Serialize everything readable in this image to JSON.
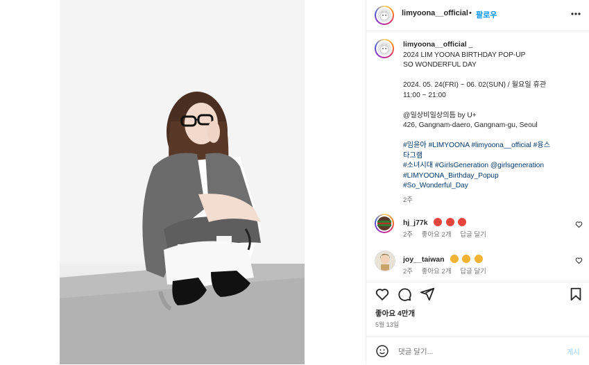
{
  "post": {
    "author": "limyoona__official",
    "dot": "•",
    "follow_label": "팔로우",
    "more_icon": "more-horizontal-icon"
  },
  "caption": {
    "author": "limyoona__official",
    "lines": [
      "_",
      "2024 LIM YOONA BIRTHDAY POP-UP",
      "SO WONDERFUL DAY",
      "",
      "2024. 05. 24(FRI) ~ 06. 02(SUN) / 월요일 휴관",
      "11:00 ~ 21:00",
      "",
      "@일상비일상의틈 by U+",
      "426, Gangnam-daero, Gangnam-gu, Seoul"
    ],
    "hashtags": [
      "#임윤아 #LIMYOONA #limyoona__official #융스",
      "타그램",
      "#소녀시대 #GirlsGeneration @girlsgeneration",
      "#LIMYOONA_Birthday_Popup",
      "#So_Wonderful_Day"
    ],
    "time": "2주"
  },
  "comments": [
    {
      "user": "hj_j77k",
      "emoji_count": 3,
      "emoji_color": "#e8453c",
      "time": "2주",
      "likes": "좋아요 2개",
      "reply": "답글 달기"
    },
    {
      "user": "joy__taiwan",
      "emoji_count": 3,
      "emoji_color": "#f2b233",
      "time": "2주",
      "likes": "좋아요 2개",
      "reply": "답글 달기"
    }
  ],
  "actions": {
    "like_icon": "heart-icon",
    "comment_icon": "comment-icon",
    "share_icon": "send-icon",
    "save_icon": "bookmark-icon"
  },
  "likes": "좋아요 4만개",
  "date": "5월 13일",
  "comment_bar": {
    "placeholder": "댓글 달기...",
    "post_label": "게시"
  }
}
